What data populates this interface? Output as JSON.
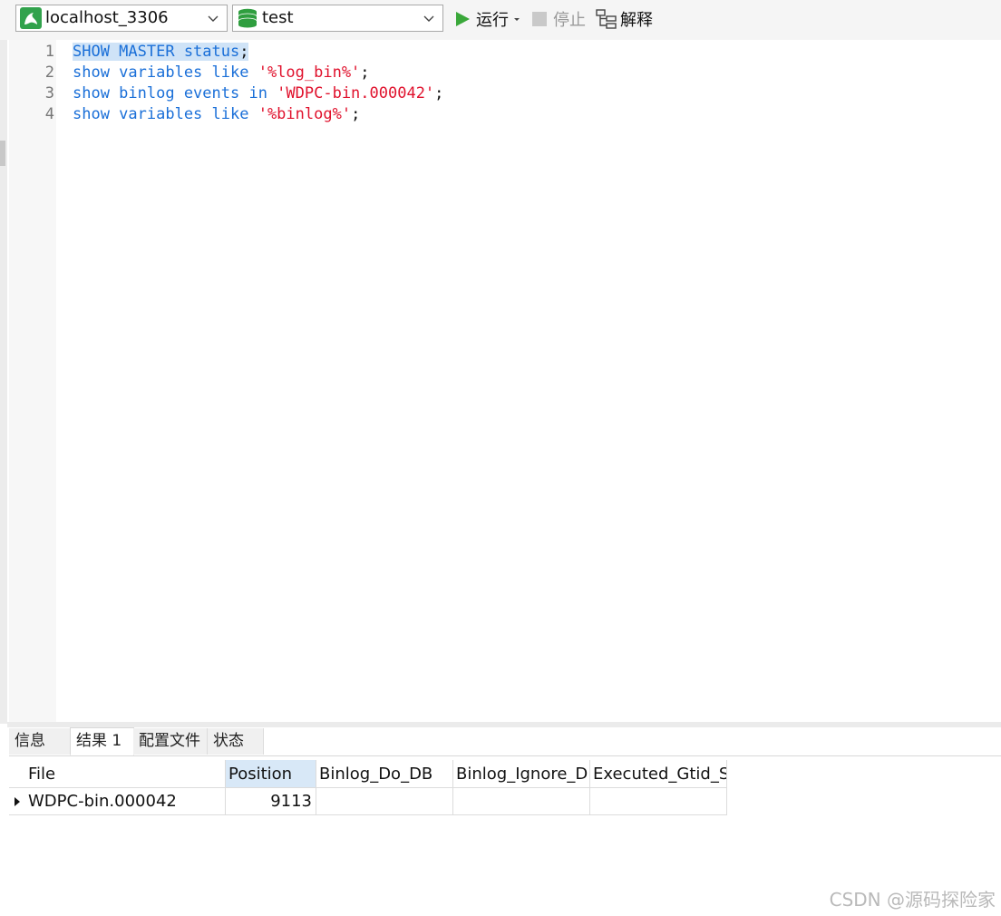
{
  "toolbar": {
    "connection": {
      "value": "localhost_3306",
      "icon": "dolphin-connection-icon"
    },
    "database": {
      "value": "test",
      "icon": "database-stack-icon"
    },
    "run_label": "运行",
    "stop_label": "停止",
    "explain_label": "解释",
    "colors": {
      "run": "#3aa83a",
      "database": "#2f9e3f",
      "connection": "#31a24c"
    }
  },
  "editor": {
    "line_numbers": [
      "1",
      "2",
      "3",
      "4"
    ],
    "lines": [
      [
        {
          "t": "SHOW MASTER status",
          "c": "kw"
        },
        {
          "t": ";",
          "c": "pn"
        }
      ],
      [
        {
          "t": "show variables like ",
          "c": "kw"
        },
        {
          "t": "'%log_bin%'",
          "c": "str"
        },
        {
          "t": ";",
          "c": "pn"
        }
      ],
      [
        {
          "t": "show binlog events in ",
          "c": "kw"
        },
        {
          "t": "'WDPC-bin.000042'",
          "c": "str"
        },
        {
          "t": ";",
          "c": "pn"
        }
      ],
      [
        {
          "t": "show variables like ",
          "c": "kw"
        },
        {
          "t": "'%binlog%'",
          "c": "str"
        },
        {
          "t": ";",
          "c": "pn"
        }
      ]
    ],
    "selected_line": 1
  },
  "tabs": {
    "info": "信息",
    "result1": "结果 1",
    "profile": "配置文件",
    "status": "状态",
    "active": "result1"
  },
  "grid": {
    "columns": [
      "File",
      "Position",
      "Binlog_Do_DB",
      "Binlog_Ignore_DB",
      "Executed_Gtid_Set"
    ],
    "sorted_column": "Position",
    "rows": [
      [
        "WDPC-bin.000042",
        "9113",
        "",
        "",
        ""
      ]
    ]
  },
  "watermark": "CSDN @源码探险家"
}
